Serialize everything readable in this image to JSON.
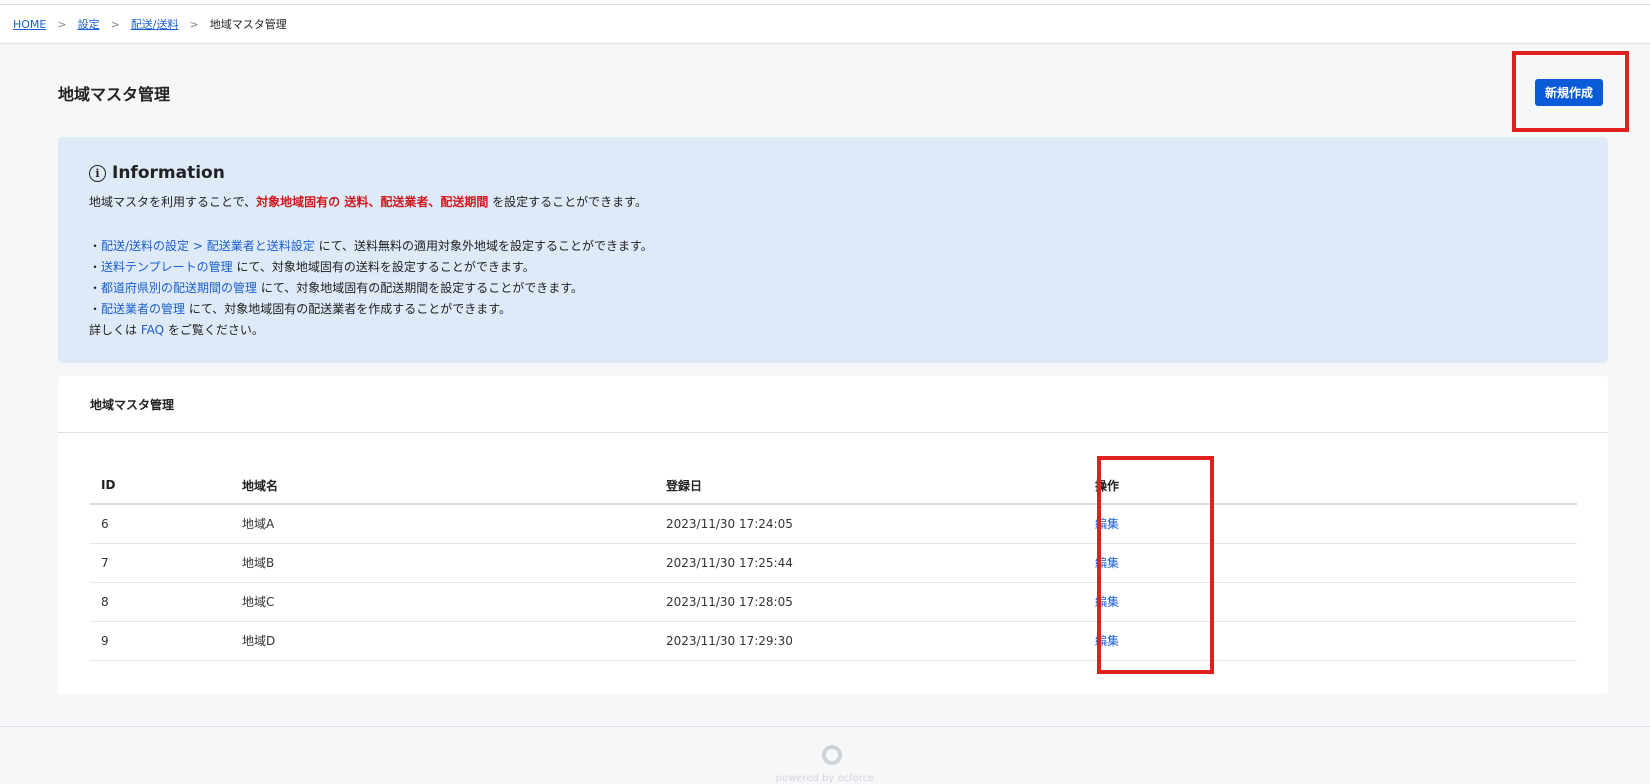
{
  "breadcrumb": {
    "items": [
      {
        "label": "HOME"
      },
      {
        "label": "設定"
      },
      {
        "label": "配送/送料"
      }
    ],
    "separator": ">",
    "current": "地域マスタ管理"
  },
  "page": {
    "title": "地域マスタ管理",
    "new_button": "新規作成"
  },
  "info": {
    "heading": "Information",
    "icon": "info-circle-icon",
    "intro_before": "地域マスタを利用することで、",
    "intro_highlight": "対象地域固有の 送料、配送業者、配送期間",
    "intro_after": " を設定することができます。",
    "bullets": [
      {
        "prefix": "・",
        "link": "配送/送料の設定 > 配送業者と送料設定",
        "text": " にて、送料無料の適用対象外地域を設定することができます。"
      },
      {
        "prefix": "・",
        "link": "送料テンプレートの管理",
        "text": " にて、対象地域固有の送料を設定することができます。"
      },
      {
        "prefix": "・",
        "link": "都道府県別の配送期間の管理",
        "text": " にて、対象地域固有の配送期間を設定することができます。"
      },
      {
        "prefix": "・",
        "link": "配送業者の管理",
        "text": " にて、対象地域固有の配送業者を作成することができます。"
      }
    ],
    "faq_before": "詳しくは ",
    "faq_link": "FAQ",
    "faq_after": " をご覧ください。"
  },
  "table": {
    "card_title": "地域マスタ管理",
    "columns": [
      "ID",
      "地域名",
      "登録日",
      "操作"
    ],
    "rows": [
      {
        "id": "6",
        "name": "地域A",
        "date": "2023/11/30 17:24:05",
        "action": "編集"
      },
      {
        "id": "7",
        "name": "地域B",
        "date": "2023/11/30 17:25:44",
        "action": "編集"
      },
      {
        "id": "8",
        "name": "地域C",
        "date": "2023/11/30 17:28:05",
        "action": "編集"
      },
      {
        "id": "9",
        "name": "地域D",
        "date": "2023/11/30 17:29:30",
        "action": "編集"
      }
    ]
  },
  "footer": {
    "text": "powered by ecforce",
    "icon": "ecforce-logo-icon"
  },
  "colors": {
    "accent": "#0a5bd8",
    "link": "#1a5fd0",
    "highlight_red": "#d0191e",
    "annotation_box": "#e0201c",
    "info_bg": "#dfeaf8"
  }
}
